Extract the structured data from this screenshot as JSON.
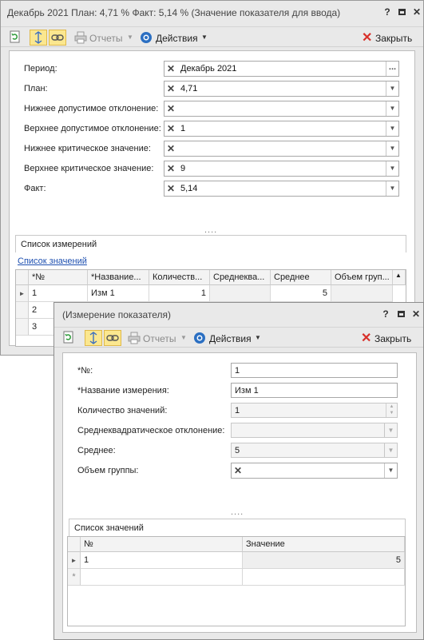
{
  "main_window": {
    "title": "Декабрь 2021  План: 4,71 %  Факт: 5,14 % (Значение показателя для ввода)",
    "help_btn": "?",
    "restore_btn": "▫",
    "close_btn": "✕",
    "toolbar": {
      "reports_label": "Отчеты",
      "actions_label": "Действия",
      "close_label": "Закрыть"
    },
    "fields": [
      {
        "label": "Период:",
        "value": "Декабрь 2021"
      },
      {
        "label": "План:",
        "value": "4,71"
      },
      {
        "label": "Нижнее допустимое отклонение:",
        "value": ""
      },
      {
        "label": "Верхнее допустимое отклонение:",
        "value": "1"
      },
      {
        "label": "Нижнее критическое значение:",
        "value": ""
      },
      {
        "label": "Верхнее критическое значение:",
        "value": "9"
      },
      {
        "label": "Факт:",
        "value": "5,14"
      }
    ],
    "splitter_dots": "....",
    "tab_label": "Список измерений",
    "link_label": "Список значений",
    "grid": {
      "columns": [
        "*№",
        "*Название...",
        "Количеств...",
        "Среднеква...",
        "Среднее",
        "Объем груп..."
      ],
      "rows": [
        [
          "1",
          "Изм 1",
          "1",
          "",
          "5",
          ""
        ],
        [
          "2",
          "",
          "",
          "",
          "",
          ""
        ],
        [
          "3",
          "",
          "",
          "",
          "",
          ""
        ]
      ]
    }
  },
  "dialog": {
    "title": "(Измерение показателя)",
    "help_btn": "?",
    "restore_btn": "▫",
    "close_btn": "✕",
    "toolbar": {
      "reports_label": "Отчеты",
      "actions_label": "Действия",
      "close_label": "Закрыть"
    },
    "fields": [
      {
        "label": "*№:",
        "value": "1"
      },
      {
        "label": "*Название измерения:",
        "value": "Изм 1"
      },
      {
        "label": "Количество значений:",
        "value": "1"
      },
      {
        "label": "Среднеквадратическое отклонение:",
        "value": ""
      },
      {
        "label": "Среднее:",
        "value": "5"
      },
      {
        "label": "Объем группы:",
        "value": ""
      }
    ],
    "splitter_dots": "....",
    "tab_label": "Список значений",
    "grid": {
      "columns": [
        "№",
        "Значение"
      ],
      "rows": [
        [
          "1",
          "5"
        ]
      ],
      "new_row_marker": "*"
    }
  },
  "icons": [
    "refresh-icon",
    "expand-icon",
    "link-icon",
    "print-icon",
    "actions-icon",
    "close-red-icon",
    "dropdown-arrow-icon",
    "clear-x-icon",
    "ellipsis-icon",
    "row-pointer-icon"
  ],
  "colors": {
    "toggle_bg": "#fbe78f",
    "link": "#1d4fb0",
    "close_x": "#d8302a",
    "actions_blue": "#2b6fc2"
  }
}
